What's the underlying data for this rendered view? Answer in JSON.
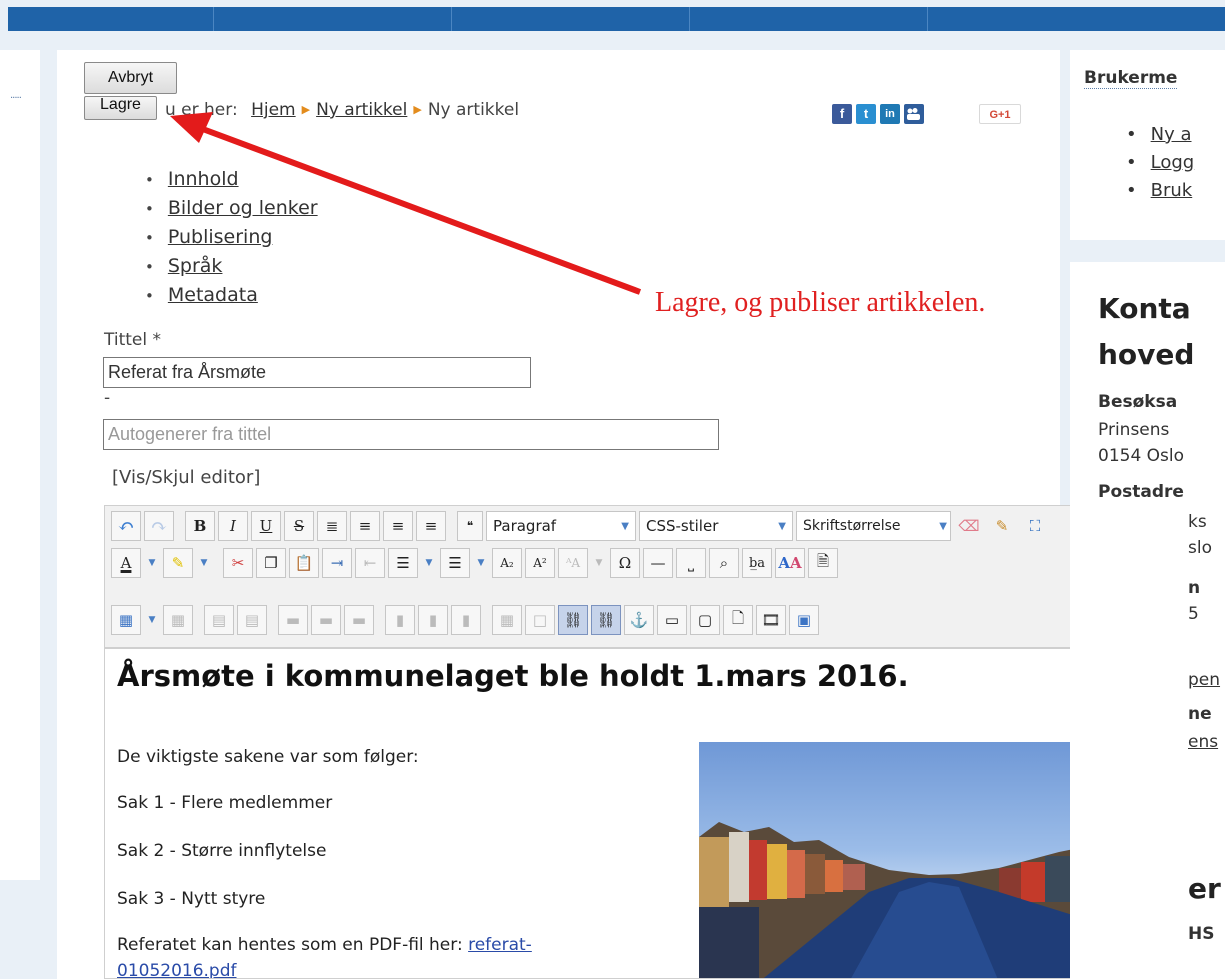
{
  "buttons": {
    "cancel": "Avbryt",
    "save": "Lagre"
  },
  "breadcrumb": {
    "prefix": "Du er her:",
    "home": "Hjem",
    "level1": "Ny artikkel",
    "current": "Ny artikkel"
  },
  "social": [
    "f",
    "t",
    "in",
    "",
    "G+1"
  ],
  "submenu": [
    "Innhold",
    "Bilder og lenker",
    "Publisering",
    "Språk",
    "Metadata"
  ],
  "form": {
    "title_label": "Tittel *",
    "title_value": "Referat fra Årsmøte",
    "alias_dash": "-",
    "alias_placeholder": "Autogenerer fra tittel",
    "toggle_editor": "[Vis/Skjul editor]"
  },
  "annotation": "Lagre, og publiser artikkelen.",
  "toolbar": {
    "format_select": "Paragraf",
    "css_select": "CSS-stiler",
    "fontsize_select": "Skriftstørrelse"
  },
  "editor": {
    "heading": "Årsmøte i kommunelaget ble holdt 1.mars 2016.",
    "intro": "De viktigste sakene var som følger:",
    "items": [
      "Sak 1 - Flere medlemmer",
      "Sak 2 - Større innflytelse",
      "Sak 3 - Nytt styre"
    ],
    "pdf_text": "Referatet kan hentes som en PDF-fil her:",
    "pdf_link_1": "referat-",
    "pdf_link_2": "01052016.pdf"
  },
  "right_panel": {
    "user_menu_title": "Brukerme",
    "user_links": [
      "Ny a",
      "Logg",
      "Bruk"
    ],
    "contact_title_1": "Konta",
    "contact_title_2": "hoved",
    "visit_label": "Besøksa",
    "visit_line1": "Prinsens",
    "visit_line2": "0154 Oslo",
    "post_label": "Postadre",
    "post_line1": "ks",
    "post_line2": "slo",
    "partial_1": "n",
    "partial_2": "5",
    "partial_3": "pen",
    "partial_4": "ne",
    "partial_5": "ens",
    "partial_6": "er",
    "partial_7": "HS"
  },
  "colors": {
    "topbar": "#1f63a8",
    "annotation": "#e02020",
    "arrow": "#e31b1b"
  }
}
